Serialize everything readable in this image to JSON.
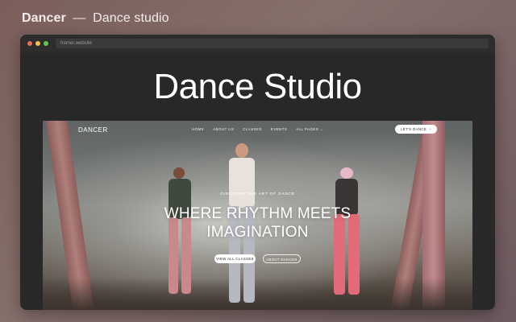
{
  "caption": {
    "brand": "Dancer",
    "separator": "—",
    "subtitle": "Dance studio"
  },
  "browser": {
    "url": "framer.website"
  },
  "headline": "Dance Studio",
  "site": {
    "brand": "DANCER",
    "nav": [
      "HOME",
      "ABOUT US",
      "CLASSES",
      "EVENTS",
      "ALL PAGES ⌄"
    ],
    "cta_label": "LET'S DANCE",
    "cta_icon": "arrow-right-icon",
    "eyebrow": "DISCOVER THE ART OF DANCE",
    "title_line1": "WHERE RHYTHM MEETS",
    "title_line2": "IMAGINATION",
    "primary_button": "VIEW ALL CLASSES",
    "secondary_button": "ABOUT DANCER"
  }
}
